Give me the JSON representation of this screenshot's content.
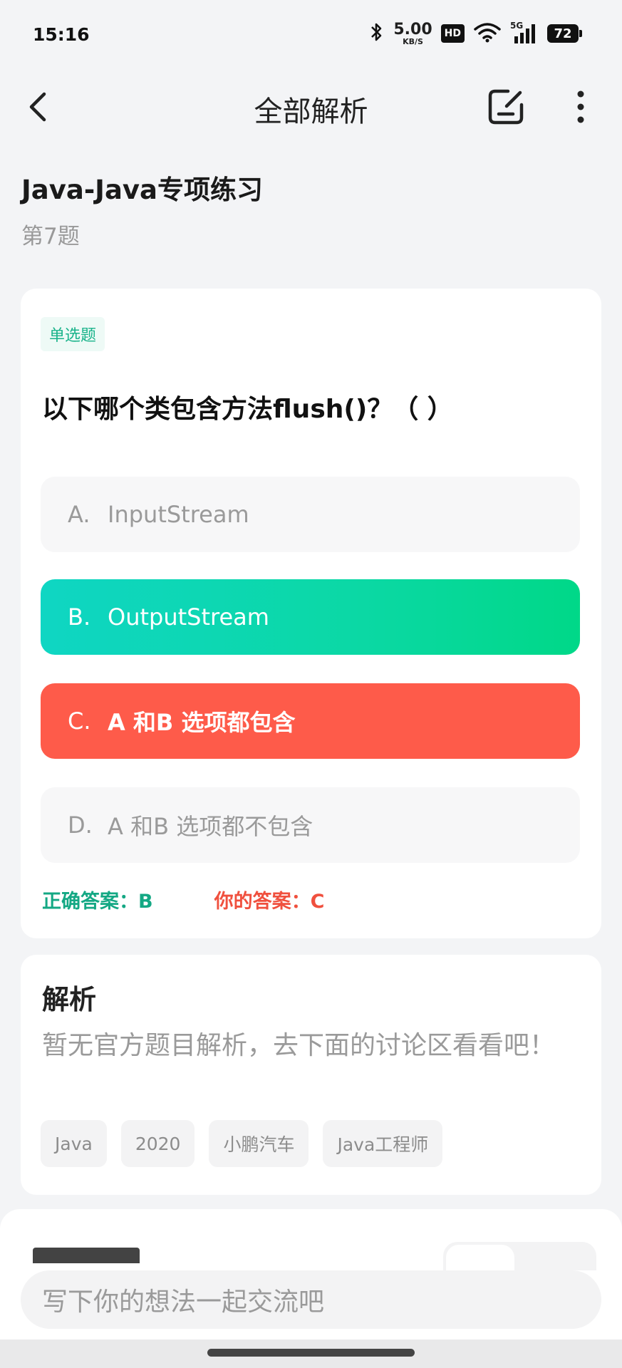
{
  "status_bar": {
    "time": "15:16",
    "net_speed_value": "5.00",
    "net_speed_unit": "KB/S",
    "hd_badge": "HD",
    "network": "5G",
    "battery": "72"
  },
  "nav": {
    "title": "全部解析",
    "back_icon": "chevron-left-icon",
    "edit_icon": "edit-note-icon",
    "more_icon": "more-vertical-icon"
  },
  "practice": {
    "title": "Java-Java专项练习",
    "question_number": "第7题"
  },
  "question": {
    "type": "单选题",
    "text": "以下哪个类包含方法flush()？（ ）",
    "options": [
      {
        "letter": "A.",
        "label": "InputStream",
        "state": "default"
      },
      {
        "letter": "B.",
        "label": "OutputStream",
        "state": "correct"
      },
      {
        "letter": "C.",
        "label": "A 和B 选项都包含",
        "state": "wrong"
      },
      {
        "letter": "D.",
        "label": "A 和B 选项都不包含",
        "state": "default"
      }
    ],
    "correct_answer": "正确答案：B",
    "your_answer": "你的答案：C"
  },
  "analysis": {
    "heading": "解析",
    "text": "暂无官方题目解析，去下面的讨论区看看吧！",
    "tags": [
      "Java",
      "2020",
      "小鹏汽车",
      "Java工程师"
    ]
  },
  "discussion": {
    "input_placeholder": "写下你的想法一起交流吧"
  },
  "colors": {
    "correct": "#0bd8a4",
    "wrong": "#fe5b4a",
    "accent_text": "#14a884"
  }
}
